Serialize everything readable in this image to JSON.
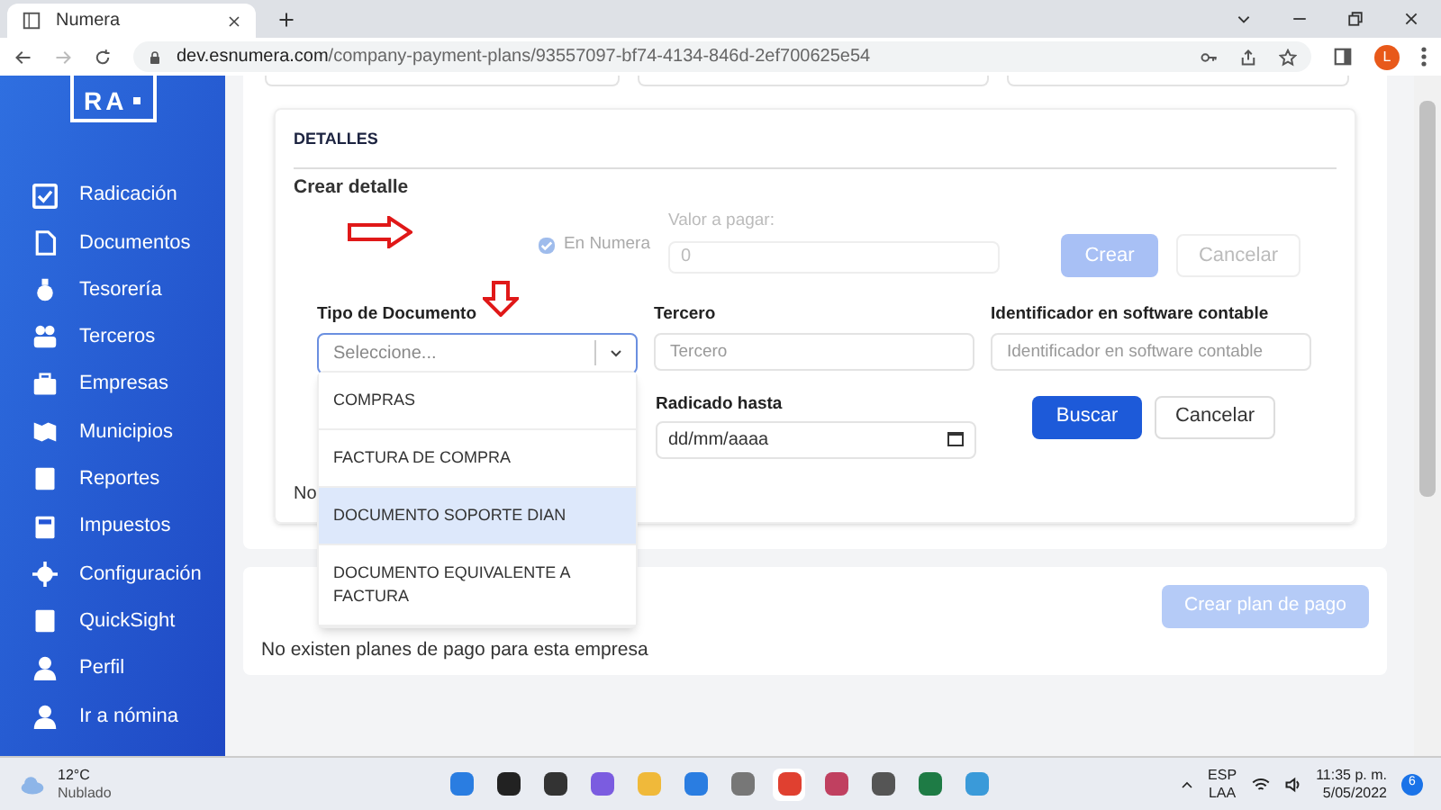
{
  "browser": {
    "tab_title": "Numera",
    "url_host": "dev.esnumera.com",
    "url_path": "/company-payment-plans/93557097-bf74-4134-846d-2ef700625e54",
    "profile": "L"
  },
  "sidebar": {
    "logo": "RA",
    "items": [
      {
        "label": "Radicación"
      },
      {
        "label": "Documentos"
      },
      {
        "label": "Tesorería"
      },
      {
        "label": "Terceros"
      },
      {
        "label": "Empresas"
      },
      {
        "label": "Municipios"
      },
      {
        "label": "Reportes"
      },
      {
        "label": "Impuestos"
      },
      {
        "label": "Configuración"
      },
      {
        "label": "QuickSight"
      },
      {
        "label": "Perfil"
      },
      {
        "label": "Ir a nómina"
      }
    ]
  },
  "detalles": {
    "heading": "DETALLES",
    "subheading": "Crear detalle",
    "en_numera": {
      "label": "En Numera",
      "checked": true,
      "disabled": true
    },
    "valor": {
      "label": "Valor a pagar:",
      "placeholder": "0",
      "disabled": true
    },
    "buttons": [
      {
        "label": "Crear",
        "kind": "primary",
        "disabled": true
      },
      {
        "label": "Cancelar",
        "kind": "secondary",
        "disabled": true
      }
    ]
  },
  "filters": {
    "fields": [
      {
        "kind": "select",
        "label": "Tipo de Documento",
        "placeholder": "Seleccione..."
      },
      {
        "kind": "text",
        "label": "Tercero",
        "placeholder": "Tercero"
      },
      {
        "kind": "text",
        "label": "Identificador en software contable",
        "placeholder": "Identificador en software contable"
      },
      {
        "kind": "date",
        "label": "Radicado hasta",
        "placeholder": "dd/mm/aaaa"
      }
    ],
    "buttons": [
      {
        "label": "Buscar",
        "kind": "primary",
        "disabled": false
      },
      {
        "label": "Cancelar",
        "kind": "secondary",
        "disabled": false
      }
    ],
    "cut_text": "No"
  },
  "dropdown": {
    "options": [
      {
        "label": "COMPRAS",
        "selected": false
      },
      {
        "label": "FACTURA DE COMPRA",
        "selected": false
      },
      {
        "label": "DOCUMENTO SOPORTE DIAN",
        "selected": true
      },
      {
        "label": "DOCUMENTO EQUIVALENTE A FACTURA",
        "selected": false
      }
    ]
  },
  "plans": {
    "button": {
      "label": "Crear plan de pago",
      "disabled": true
    },
    "empty_text": "No existen planes de pago para esta empresa"
  },
  "taskbar": {
    "temperature": "12°C",
    "condition": "Nublado",
    "language": "ESP",
    "layout": "LAA",
    "time": "11:35 p. m.",
    "date": "5/05/2022",
    "notifications": "6"
  }
}
